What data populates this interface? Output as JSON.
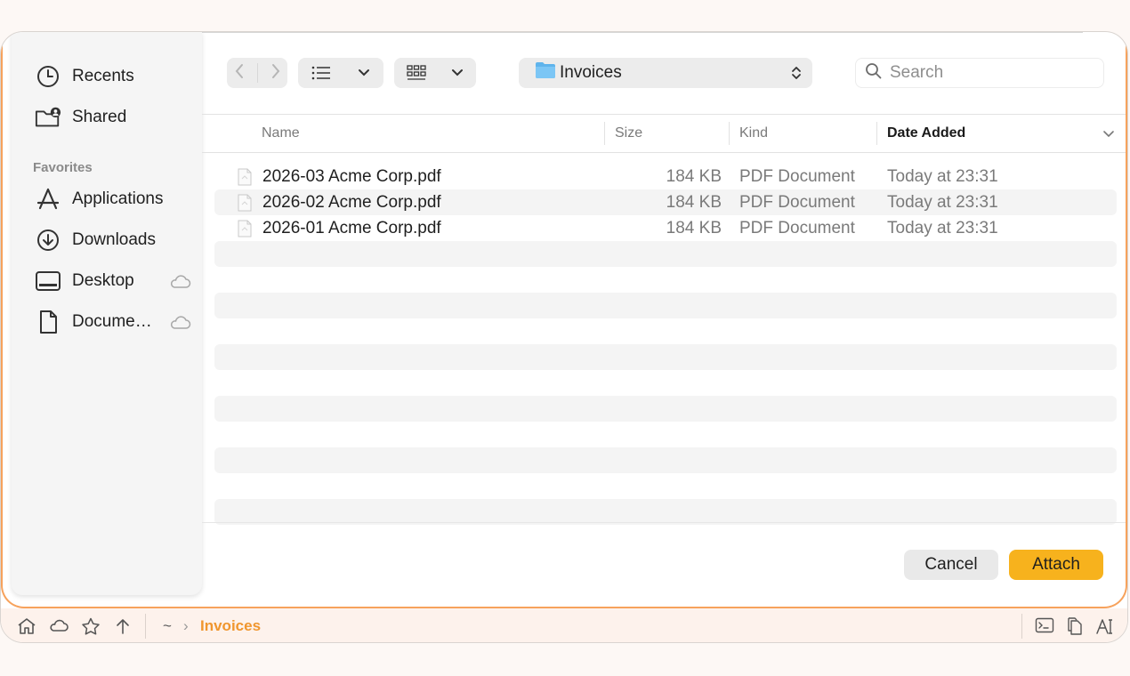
{
  "sidebar": {
    "items": [
      {
        "label": "Recents",
        "icon": "clock-icon"
      },
      {
        "label": "Shared",
        "icon": "shared-folder-icon"
      }
    ],
    "favorites_header": "Favorites",
    "favorites": [
      {
        "label": "Applications",
        "icon": "applications-icon"
      },
      {
        "label": "Downloads",
        "icon": "download-icon"
      },
      {
        "label": "Desktop",
        "icon": "desktop-icon",
        "cloud": true
      },
      {
        "label": "Docume…",
        "icon": "document-icon",
        "cloud": true
      }
    ]
  },
  "toolbar": {
    "location": "Invoices",
    "search_placeholder": "Search"
  },
  "columns": {
    "name": "Name",
    "size": "Size",
    "kind": "Kind",
    "date_added": "Date Added"
  },
  "files": [
    {
      "name": "2026-03 Acme Corp.pdf",
      "size": "184 KB",
      "kind": "PDF Document",
      "date_added": "Today at 23:31"
    },
    {
      "name": "2026-02 Acme Corp.pdf",
      "size": "184 KB",
      "kind": "PDF Document",
      "date_added": "Today at 23:31"
    },
    {
      "name": "2026-01 Acme Corp.pdf",
      "size": "184 KB",
      "kind": "PDF Document",
      "date_added": "Today at 23:31"
    }
  ],
  "buttons": {
    "cancel": "Cancel",
    "attach": "Attach"
  },
  "pathbar": {
    "home_symbol": "~",
    "separator": "›",
    "current": "Invoices"
  },
  "colors": {
    "accent": "#f7b21d",
    "path_current": "#f0962e",
    "rim": "#f7a25c"
  }
}
